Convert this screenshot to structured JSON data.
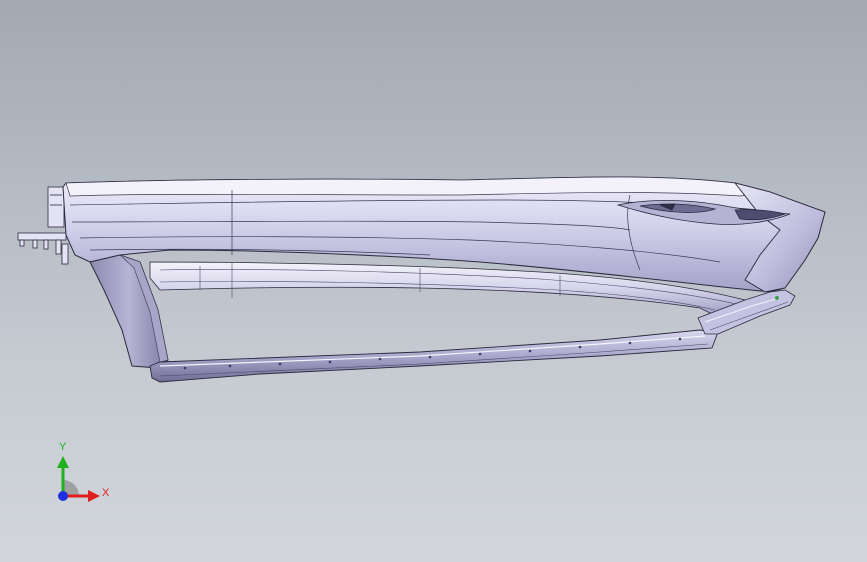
{
  "viewport": {
    "background_top": "#a2a9b3",
    "background_bottom": "#d2d6dc"
  },
  "model": {
    "body_color": "#cdcbe8",
    "highlight_color": "#f2f1fb",
    "shadow_color": "#6f6e93",
    "edge_color": "#2b2a3d"
  },
  "triad": {
    "x_label": "X",
    "y_label": "Y",
    "x_color": "#e02020",
    "y_color": "#20b020",
    "z_color": "#2030e0"
  }
}
